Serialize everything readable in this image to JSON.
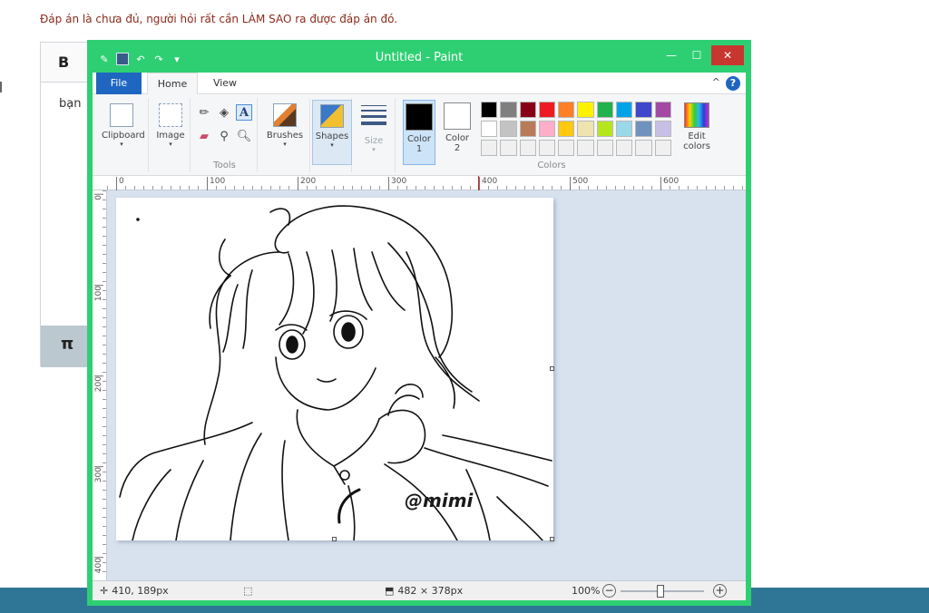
{
  "page": {
    "top_note": "Đáp án là chưa đủ, người hỏi rất cần LÀM SAO ra được đáp án đó.",
    "editor_bold_label": "B",
    "editor_text": "bạn",
    "editor_pi_label": "π"
  },
  "window": {
    "title": "Untitled - Paint",
    "min_glyph": "—",
    "max_glyph": "☐",
    "close_glyph": "✕"
  },
  "tabs": {
    "file": "File",
    "home": "Home",
    "view": "View",
    "help_glyph": "?",
    "collapse_glyph": "^"
  },
  "ribbon": {
    "clipboard": "Clipboard",
    "image": "Image",
    "tools_group": "Tools",
    "brushes": "Brushes",
    "shapes": "Shapes",
    "size": "Size",
    "color1_line1": "Color",
    "color1_line2": "1",
    "color2_line1": "Color",
    "color2_line2": "2",
    "colors_group": "Colors",
    "edit_colors_line1": "Edit",
    "edit_colors_line2": "colors",
    "text_tool_glyph": "A",
    "dropdown_glyph": "▾"
  },
  "colors": {
    "color1": "#000000",
    "color2": "#ffffff",
    "palette_row1": [
      "#000000",
      "#7f7f7f",
      "#880015",
      "#ed1c24",
      "#ff7f27",
      "#fff200",
      "#22b14c",
      "#00a2e8",
      "#3f48cc",
      "#a349a4"
    ],
    "palette_row2": [
      "#ffffff",
      "#c3c3c3",
      "#b97a57",
      "#ffaec9",
      "#ffc90e",
      "#efe4b0",
      "#b5e61d",
      "#99d9ea",
      "#7092be",
      "#c8bfe7"
    ],
    "palette_row3": [
      "#f0f0f0",
      "#f0f0f0",
      "#f0f0f0",
      "#f0f0f0",
      "#f0f0f0",
      "#f0f0f0",
      "#f0f0f0",
      "#f0f0f0",
      "#f0f0f0",
      "#f0f0f0"
    ]
  },
  "ruler": {
    "h_labels": [
      "0",
      "100",
      "200",
      "300",
      "400",
      "500",
      "600"
    ],
    "v_labels": [
      "0",
      "100",
      "200",
      "300",
      "400"
    ]
  },
  "canvas": {
    "watermark": "@mimi"
  },
  "status": {
    "cursor_pos": "410, 189px",
    "canvas_size": "482 × 378px",
    "zoom": "100%",
    "zoom_out_glyph": "−",
    "zoom_in_glyph": "+"
  }
}
